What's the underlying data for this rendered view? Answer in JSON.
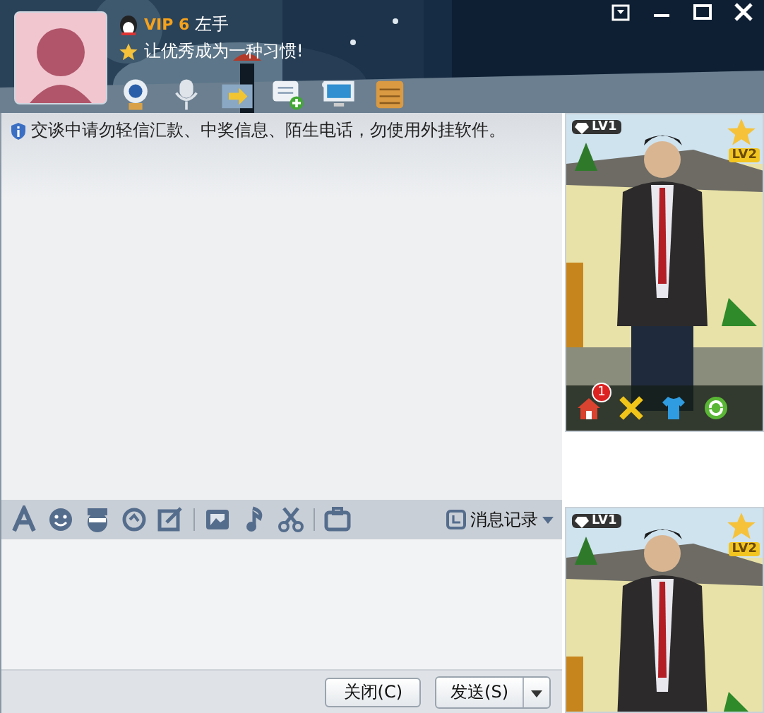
{
  "profile": {
    "vip": "VIP 6",
    "name": "左手",
    "signature": "让优秀成为一种习惯!"
  },
  "chat": {
    "notice": "交谈中请勿轻信汇款、中奖信息、陌生电话，勿使用外挂软件。"
  },
  "toolbar": {
    "history": "消息记录"
  },
  "buttons": {
    "close": "关闭(C)",
    "send": "发送(S)"
  },
  "show_panels": [
    {
      "level_left": "LV1",
      "level_right": "LV2",
      "badge": "1"
    },
    {
      "level_left": "LV1",
      "level_right": "LV2"
    }
  ]
}
